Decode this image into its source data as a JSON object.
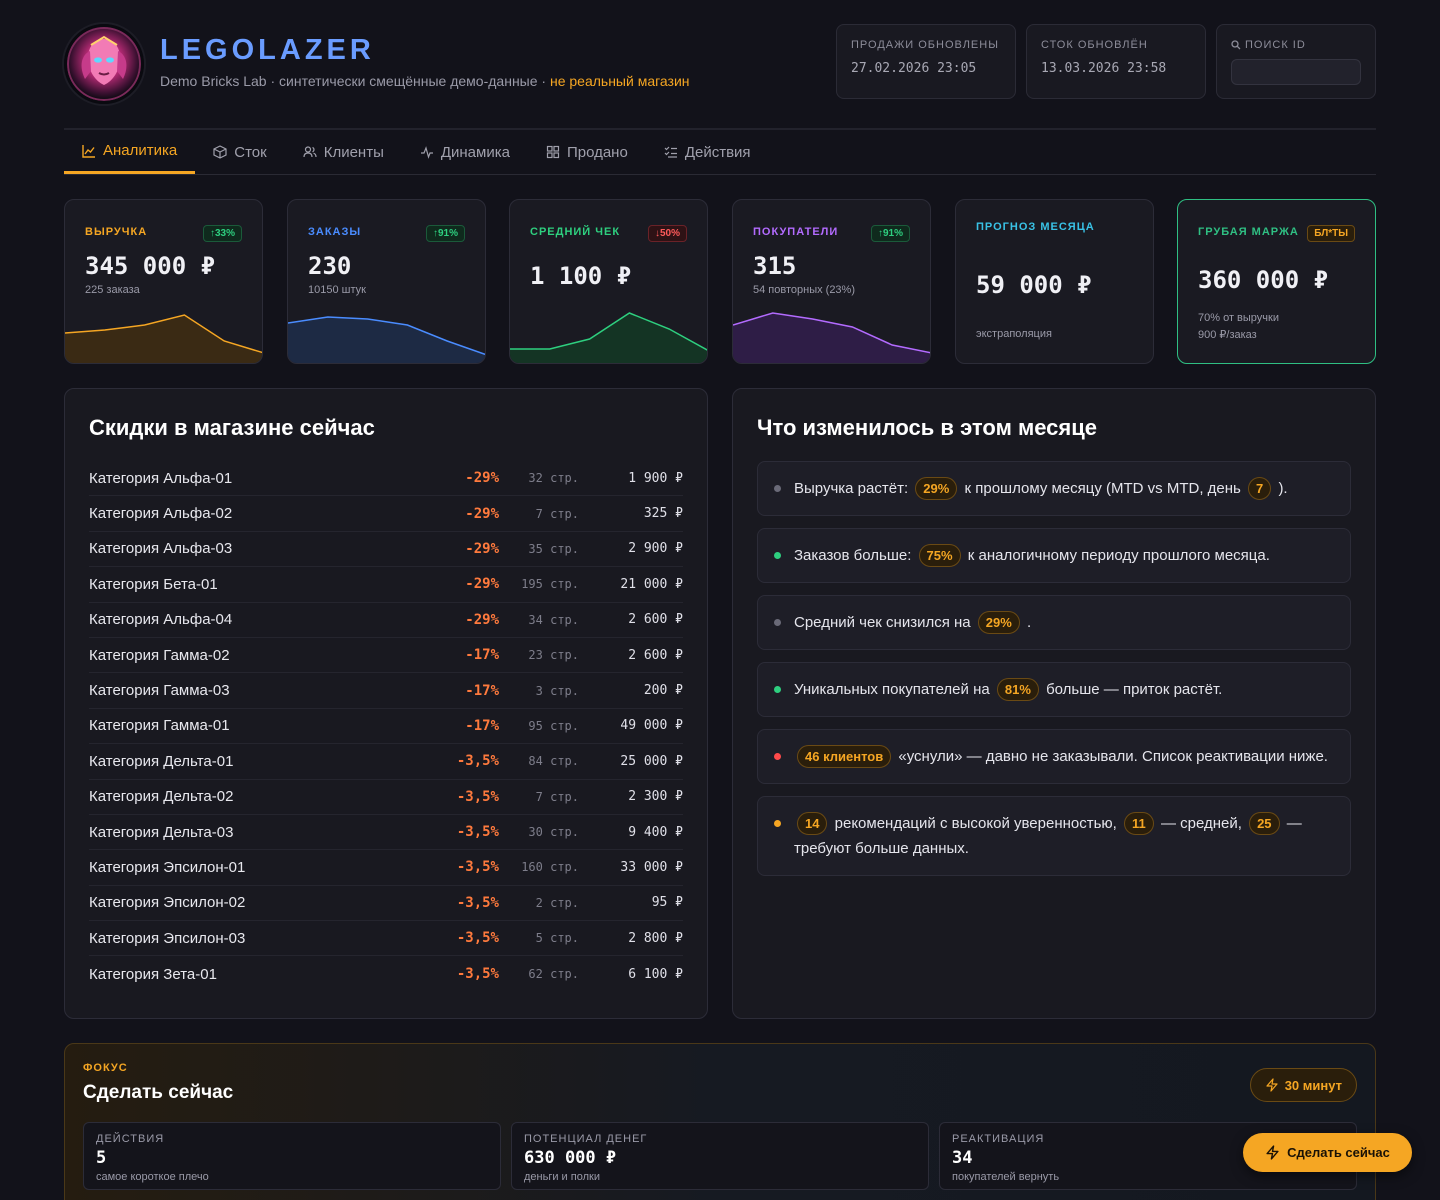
{
  "brand": {
    "title": "LEGOLAZER",
    "subtitle": "Demo Bricks Lab · синтетически смещённые демо-данные · ",
    "warning": "не реальный магазин"
  },
  "header_cards": {
    "sales_label": "ПРОДАЖИ ОБНОВЛЕНЫ",
    "sales_value": "27.02.2026 23:05",
    "stock_label": "СТОК ОБНОВЛЁН",
    "stock_value": "13.03.2026 23:58",
    "search_label": "ПОИСК ID",
    "search_value": ""
  },
  "tabs": [
    {
      "label": "Аналитика",
      "icon": "chart-line-icon"
    },
    {
      "label": "Сток",
      "icon": "box-icon"
    },
    {
      "label": "Клиенты",
      "icon": "users-icon"
    },
    {
      "label": "Динамика",
      "icon": "pulse-icon"
    },
    {
      "label": "Продано",
      "icon": "grid-icon"
    },
    {
      "label": "Действия",
      "icon": "list-check-icon"
    }
  ],
  "kpis": [
    {
      "label": "ВЫРУЧКА",
      "badge": "↑33%",
      "value": "345 000 ₽",
      "sub": "225 заказа",
      "color": "#f5a623",
      "fill": "#3a2a14",
      "spark": [
        30,
        33,
        38,
        48,
        22,
        10
      ]
    },
    {
      "label": "ЗАКАЗЫ",
      "badge": "↑91%",
      "value": "230",
      "sub": "10150 штук",
      "color": "#4a8cff",
      "fill": "#1d2a44",
      "spark": [
        40,
        46,
        44,
        38,
        22,
        8
      ]
    },
    {
      "label": "СРЕДНИЙ ЧЕК",
      "badge": "↓50%",
      "value": "1 100 ₽",
      "sub": "",
      "color": "#2ecf7f",
      "fill": "#143424",
      "spark": [
        14,
        14,
        24,
        50,
        34,
        12
      ]
    },
    {
      "label": "ПОКУПАТЕЛИ",
      "badge": "↑91%",
      "value": "315",
      "sub": "54 повторных (23%)",
      "color": "#b36bff",
      "fill": "#2e1d46",
      "spark": [
        38,
        50,
        44,
        36,
        18,
        10
      ]
    },
    {
      "label": "ПРОГНОЗ МЕСЯЦА",
      "badge": "",
      "value": "59 000 ₽",
      "sub": "экстраполяция",
      "color": "#39c2e6"
    },
    {
      "label": "ГРУБАЯ МАРЖА",
      "badge": "БЛ*ТЫ",
      "value": "360 000 ₽",
      "sub1": "70% от выручки",
      "sub2": "900 ₽/заказ",
      "color": "#2fbf83"
    }
  ],
  "discounts": {
    "title": "Скидки в магазине сейчас",
    "rows": [
      {
        "name": "Категория Альфа-01",
        "pct": "-29%",
        "count": "32 стр.",
        "sum": "1 900 ₽"
      },
      {
        "name": "Категория Альфа-02",
        "pct": "-29%",
        "count": "7 стр.",
        "sum": "325 ₽"
      },
      {
        "name": "Категория Альфа-03",
        "pct": "-29%",
        "count": "35 стр.",
        "sum": "2 900 ₽"
      },
      {
        "name": "Категория Бета-01",
        "pct": "-29%",
        "count": "195 стр.",
        "sum": "21 000 ₽"
      },
      {
        "name": "Категория Альфа-04",
        "pct": "-29%",
        "count": "34 стр.",
        "sum": "2 600 ₽"
      },
      {
        "name": "Категория Гамма-02",
        "pct": "-17%",
        "count": "23 стр.",
        "sum": "2 600 ₽"
      },
      {
        "name": "Категория Гамма-03",
        "pct": "-17%",
        "count": "3 стр.",
        "sum": "200 ₽"
      },
      {
        "name": "Категория Гамма-01",
        "pct": "-17%",
        "count": "95 стр.",
        "sum": "49 000 ₽"
      },
      {
        "name": "Категория Дельта-01",
        "pct": "-3,5%",
        "count": "84 стр.",
        "sum": "25 000 ₽"
      },
      {
        "name": "Категория Дельта-02",
        "pct": "-3,5%",
        "count": "7 стр.",
        "sum": "2 300 ₽"
      },
      {
        "name": "Категория Дельта-03",
        "pct": "-3,5%",
        "count": "30 стр.",
        "sum": "9 400 ₽"
      },
      {
        "name": "Категория Эпсилон-01",
        "pct": "-3,5%",
        "count": "160 стр.",
        "sum": "33 000 ₽"
      },
      {
        "name": "Категория Эпсилон-02",
        "pct": "-3,5%",
        "count": "2 стр.",
        "sum": "95 ₽"
      },
      {
        "name": "Категория Эпсилон-03",
        "pct": "-3,5%",
        "count": "5 стр.",
        "sum": "2 800 ₽"
      },
      {
        "name": "Категория Зета-01",
        "pct": "-3,5%",
        "count": "62 стр.",
        "sum": "6 100 ₽"
      }
    ]
  },
  "changes": {
    "title": "Что изменилось в этом месяце",
    "items": [
      {
        "dot": "#6a6a78",
        "t1": "Выручка растёт:",
        "c1": "29%",
        "t2": "к прошлому месяцу (MTD vs MTD, день",
        "c2": "7",
        "t3": ")."
      },
      {
        "dot": "#2ecf7f",
        "t1": "Заказов больше:",
        "c1": "75%",
        "t2": "к аналогичному периоду прошлого месяца."
      },
      {
        "dot": "#6a6a78",
        "t1": "Средний чек снизился на",
        "c1": "29%",
        "t2": "."
      },
      {
        "dot": "#2ecf7f",
        "t1": "Уникальных покупателей на",
        "c1": "81%",
        "t2": "больше — приток растёт."
      },
      {
        "dot": "#ff4a4a",
        "t1": "",
        "c1": "46 клиентов",
        "t2": "«уснули» — давно не заказывали. Список реактивации ниже."
      },
      {
        "dot": "#f5a623",
        "t1": "",
        "c1": "14",
        "t2": "рекомендаций с высокой уверенностью,",
        "c2": "11",
        "t3": "— средней,",
        "c3": "25",
        "t4": "— требуют больше данных."
      }
    ]
  },
  "focus": {
    "label": "ФОКУС",
    "title": "Сделать сейчас",
    "time": "30 минут",
    "boxes": [
      {
        "label": "ДЕЙСТВИЯ",
        "value": "5",
        "sub": "самое короткое плечо"
      },
      {
        "label": "ПОТЕНЦИАЛ ДЕНЕГ",
        "value": "630 000 ₽",
        "sub": "деньги и полки"
      },
      {
        "label": "РЕАКТИВАЦИЯ",
        "value": "34",
        "sub": "покупателей вернуть"
      }
    ]
  },
  "cta": {
    "label": "Сделать сейчас"
  }
}
